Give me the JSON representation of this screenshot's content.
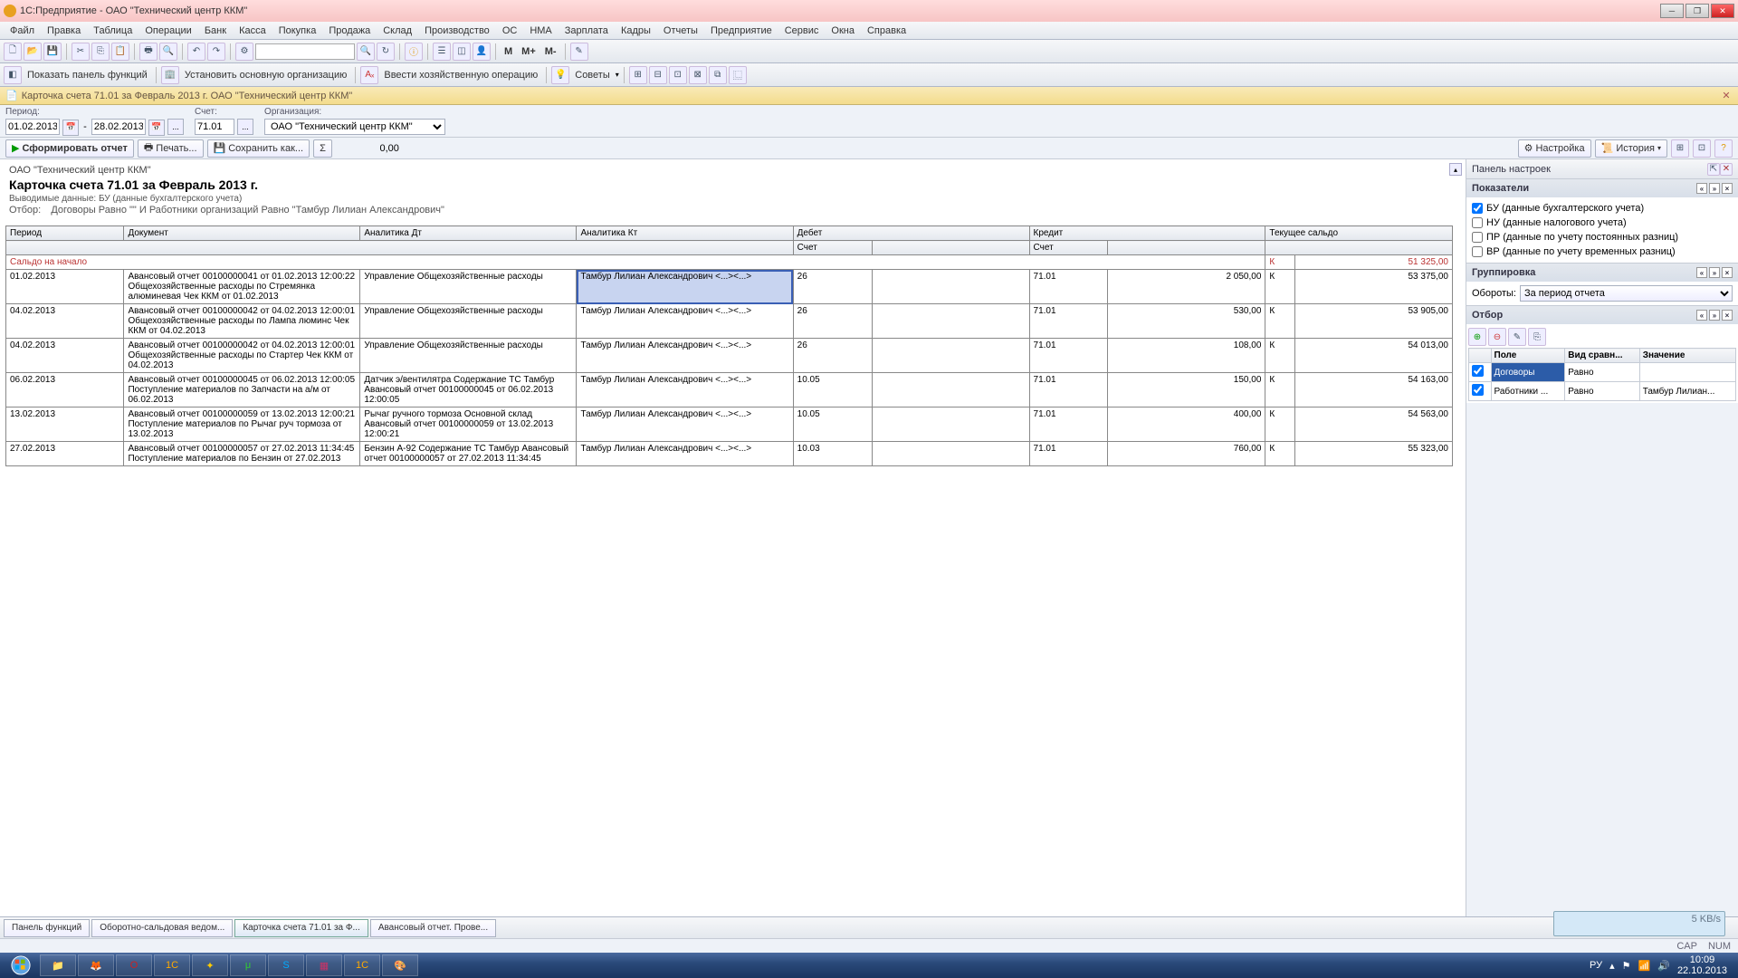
{
  "title": "1С:Предприятие - ОАО  \"Технический центр  ККМ\"",
  "menu": [
    "Файл",
    "Правка",
    "Таблица",
    "Операции",
    "Банк",
    "Касса",
    "Покупка",
    "Продажа",
    "Склад",
    "Производство",
    "ОС",
    "НМА",
    "Зарплата",
    "Кадры",
    "Отчеты",
    "Предприятие",
    "Сервис",
    "Окна",
    "Справка"
  ],
  "toolbar2": {
    "show_panel": "Показать панель функций",
    "set_org": "Установить основную организацию",
    "enter_op": "Ввести хозяйственную операцию",
    "advice": "Советы"
  },
  "breadcrumb": "Карточка счета 71.01 за Февраль 2013 г. ОАО  \"Технический центр  ККМ\"",
  "filters": {
    "period_lbl": "Период:",
    "from": "01.02.2013",
    "to": "28.02.2013",
    "acct_lbl": "Счет:",
    "acct": "71.01",
    "org_lbl": "Организация:",
    "org": "ОАО  \"Технический центр  ККМ\""
  },
  "actions": {
    "form": "Сформировать отчет",
    "print": "Печать...",
    "save": "Сохранить как...",
    "sigma": "Σ",
    "sigma_val": "0,00",
    "settings": "Настройка",
    "history": "История"
  },
  "report": {
    "org": "ОАО  \"Технический центр  ККМ\"",
    "title": "Карточка счета 71.01 за Февраль 2013 г.",
    "meta1": "Выводимые данные:  БУ (данные бухгалтерского учета)",
    "meta2_lbl": "Отбор:",
    "meta2": "Договоры Равно \"\" И Работники организаций Равно \"Тамбур Лилиан Александрович\"",
    "cols": [
      "Период",
      "Документ",
      "Аналитика Дт",
      "Аналитика Кт",
      "Дебет",
      "",
      "Кредит",
      "",
      "Текущее сальдо",
      ""
    ],
    "sub": [
      "",
      "",
      "",
      "",
      "Счет",
      "",
      "Счет",
      "",
      "",
      ""
    ],
    "start_lbl": "Сальдо на начало",
    "start_dk": "К",
    "start_val": "51 325,00",
    "rows": [
      {
        "d": "01.02.2013",
        "doc": "Авансовый отчет 00100000041 от 01.02.2013 12:00:22 Общехозяйственные расходы по Стремянка алюминевая Чек ККМ от 01.02.2013",
        "dt": "Управление Общехозяйственные расходы",
        "kt": "Тамбур Лилиан Александрович <...><...>",
        "dsc": "26",
        "dv": "",
        "ksc": "71.01",
        "kv": "2 050,00",
        "sdk": "К",
        "sv": "53 375,00",
        "sel": true
      },
      {
        "d": "04.02.2013",
        "doc": "Авансовый отчет 00100000042 от 04.02.2013 12:00:01 Общехозяйственные расходы по Лампа люминс Чек ККМ от 04.02.2013",
        "dt": "Управление Общехозяйственные расходы",
        "kt": "Тамбур Лилиан Александрович <...><...>",
        "dsc": "26",
        "dv": "",
        "ksc": "71.01",
        "kv": "530,00",
        "sdk": "К",
        "sv": "53 905,00"
      },
      {
        "d": "04.02.2013",
        "doc": "Авансовый отчет 00100000042 от 04.02.2013 12:00:01 Общехозяйственные расходы по Стартер Чек ККМ от 04.02.2013",
        "dt": "Управление Общехозяйственные расходы",
        "kt": "Тамбур Лилиан Александрович <...><...>",
        "dsc": "26",
        "dv": "",
        "ksc": "71.01",
        "kv": "108,00",
        "sdk": "К",
        "sv": "54 013,00"
      },
      {
        "d": "06.02.2013",
        "doc": "Авансовый отчет 00100000045 от 06.02.2013 12:00:05 Поступление материалов по Запчасти на а/м  от 06.02.2013",
        "dt": "Датчик э/вентилятра Содержание ТС Тамбур Авансовый отчет 00100000045 от 06.02.2013 12:00:05",
        "kt": "Тамбур Лилиан Александрович <...><...>",
        "dsc": "10.05",
        "dv": "",
        "ksc": "71.01",
        "kv": "150,00",
        "sdk": "К",
        "sv": "54 163,00"
      },
      {
        "d": "13.02.2013",
        "doc": "Авансовый отчет 00100000059 от 13.02.2013 12:00:21 Поступление материалов по Рычаг руч тормоза от 13.02.2013",
        "dt": "Рычаг ручного тормоза Основной склад Авансовый отчет 00100000059 от 13.02.2013 12:00:21",
        "kt": "Тамбур Лилиан Александрович <...><...>",
        "dsc": "10.05",
        "dv": "",
        "ksc": "71.01",
        "kv": "400,00",
        "sdk": "К",
        "sv": "54 563,00"
      },
      {
        "d": "27.02.2013",
        "doc": "Авансовый отчет 00100000057 от 27.02.2013 11:34:45 Поступление материалов по Бензин  от 27.02.2013",
        "dt": "Бензин А-92 Содержание ТС Тамбур Авансовый отчет 00100000057 от 27.02.2013 11:34:45",
        "kt": "Тамбур Лилиан Александрович <...><...>",
        "dsc": "10.03",
        "dv": "",
        "ksc": "71.01",
        "kv": "760,00",
        "sdk": "К",
        "sv": "55 323,00"
      }
    ]
  },
  "settings_panel": {
    "title": "Панель настроек",
    "indicators": {
      "title": "Показатели",
      "items": [
        {
          "c": true,
          "t": "БУ (данные бухгалтерского учета)"
        },
        {
          "c": false,
          "t": "НУ (данные налогового учета)"
        },
        {
          "c": false,
          "t": "ПР (данные по учету постоянных разниц)"
        },
        {
          "c": false,
          "t": "ВР (данные по учету временных разниц)"
        }
      ]
    },
    "grouping": {
      "title": "Группировка",
      "turn_lbl": "Обороты:",
      "turn_val": "За период отчета"
    },
    "filter": {
      "title": "Отбор",
      "cols": [
        "",
        "Поле",
        "Вид сравн...",
        "Значение"
      ],
      "rows": [
        {
          "c": true,
          "f": "Договоры",
          "op": "Равно",
          "v": ""
        },
        {
          "c": true,
          "f": "Работники ...",
          "op": "Равно",
          "v": "Тамбур Лилиан..."
        }
      ]
    }
  },
  "tasks": [
    "Панель функций",
    "Оборотно-сальдовая ведом...",
    "Карточка счета 71.01 за Ф...",
    "Авансовый отчет. Прове..."
  ],
  "status": {
    "cap": "CAP",
    "num": "NUM"
  },
  "tray": {
    "lang": "РУ",
    "time": "10:09",
    "date": "22.10.2013"
  },
  "net": "5 KB/s"
}
